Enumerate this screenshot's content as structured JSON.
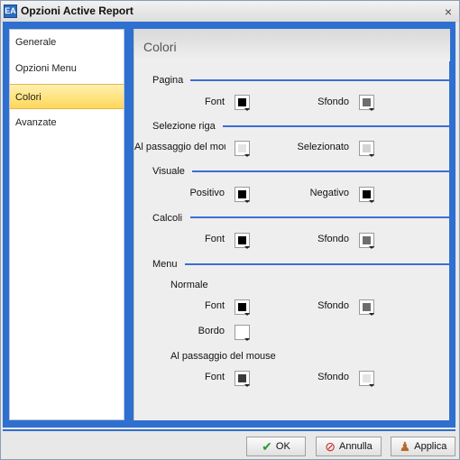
{
  "window": {
    "title": "Opzioni Active Report",
    "close_glyph": "×",
    "app_icon": "EA"
  },
  "sidebar": {
    "items": [
      {
        "label": "Generale"
      },
      {
        "label": "Opzioni Menu"
      },
      {
        "label": "Colori"
      },
      {
        "label": "Avanzate"
      }
    ]
  },
  "content": {
    "title": "Colori",
    "sections": {
      "pagina": "Pagina",
      "selezione_riga": "Selezione riga",
      "visuale": "Visuale",
      "calcoli": "Calcoli",
      "menu": "Menu",
      "normale": "Normale",
      "al_passaggio": "Al passaggio del mouse"
    },
    "labels": {
      "font": "Font",
      "sfondo": "Sfondo",
      "al_passaggio_mouse": "Al passaggio del mouse",
      "selezionato": "Selezionato",
      "positivo": "Positivo",
      "negativo": "Negativo",
      "bordo": "Bordo"
    },
    "colors": {
      "pagina_font": "#000000",
      "pagina_sfondo": "#6e6e6e",
      "riga_mouse": "#e4e4e4",
      "riga_selezionato": "#d4d4d4",
      "visuale_positivo": "#000000",
      "visuale_negativo": "#000000",
      "calcoli_font": "#000000",
      "calcoli_sfondo": "#6e6e6e",
      "menu_font": "#000000",
      "menu_sfondo": "#6e6e6e",
      "menu_bordo": "#ffffff",
      "hover_font": "#3a3a3a",
      "hover_sfondo": "#e4e4e4"
    }
  },
  "buttons": {
    "ok": "OK",
    "annulla": "Annulla",
    "applica": "Applica"
  },
  "accent": "#2e6fcf"
}
